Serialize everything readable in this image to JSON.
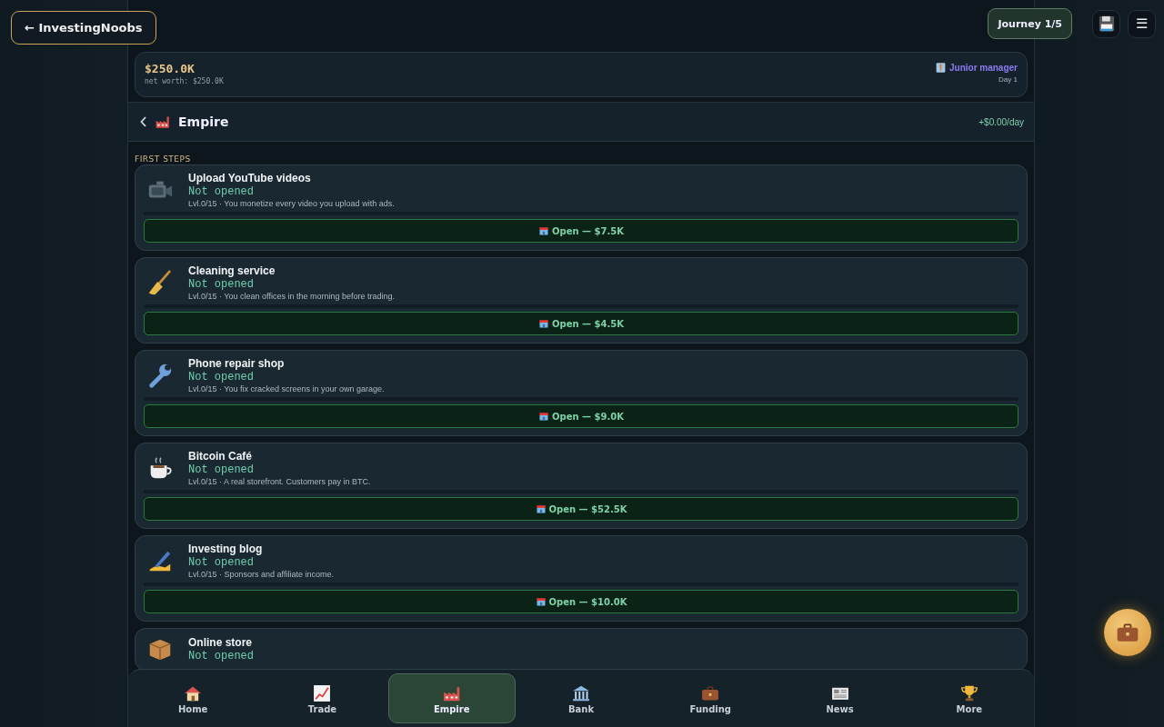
{
  "top_bar": {
    "back_label": "← InvestingNoobs",
    "journey": "Journey 1/5",
    "menu_glyph": "☰"
  },
  "stats": {
    "cash": "$250.0K",
    "net_worth": "net worth: $250.0K",
    "rank": "Junior manager",
    "day": "Day 1"
  },
  "header": {
    "title": "Empire",
    "income": "+$0.00/day"
  },
  "section": "FIRST STEPS",
  "businesses": [
    {
      "name": "Upload YouTube videos",
      "status": "Not opened",
      "info": "Lvl.0/15 · You monetize every video you upload with ads.",
      "level": 0,
      "button": "Open — $7.5K"
    },
    {
      "name": "Cleaning service",
      "status": "Not opened",
      "info": "Lvl.0/15 · You clean offices in the morning before trading.",
      "level": 0,
      "button": "Open — $4.5K"
    },
    {
      "name": "Phone repair shop",
      "status": "Not opened",
      "info": "Lvl.0/15 · You fix cracked screens in your own garage.",
      "level": 0,
      "button": "Open — $9.0K"
    },
    {
      "name": "Bitcoin Café",
      "status": "Not opened",
      "info": "Lvl.0/15 · A real storefront. Customers pay in BTC.",
      "level": 0,
      "button": "Open — $52.5K"
    },
    {
      "name": "Investing blog",
      "status": "Not opened",
      "info": "Lvl.0/15 · Sponsors and affiliate income.",
      "level": 0,
      "button": "Open — $10.0K"
    },
    {
      "name": "Online store",
      "status": "Not opened"
    }
  ],
  "nav": [
    {
      "label": "Home",
      "selected": false
    },
    {
      "label": "Trade",
      "selected": false
    },
    {
      "label": "Empire",
      "selected": true
    },
    {
      "label": "Bank",
      "selected": false
    },
    {
      "label": "Funding",
      "selected": false
    },
    {
      "label": "News",
      "selected": false
    },
    {
      "label": "More",
      "selected": false
    }
  ]
}
